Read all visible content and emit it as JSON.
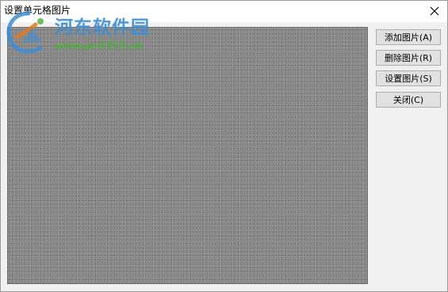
{
  "window": {
    "title": "设置单元格图片"
  },
  "watermark": {
    "brand": "河东软件园",
    "url": "www.pc0359.cn"
  },
  "buttons": {
    "add_label": "添加图片(A)",
    "delete_label": "删除图片(R)",
    "set_label": "设置图片(S)",
    "close_label": "关闭(C)"
  },
  "icons": {
    "close": "close-icon",
    "logo": "watermark-logo-icon"
  },
  "colors": {
    "image_area": "#858585",
    "watermark_blue": "#3b8ed6",
    "watermark_green": "#4caf3a",
    "button_face": "#e1e1e1"
  }
}
